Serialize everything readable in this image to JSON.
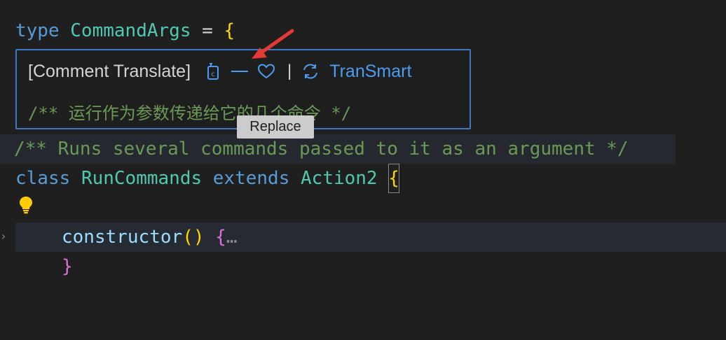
{
  "editor": {
    "line1": {
      "kw": "type",
      "name": "CommandArgs",
      "eq": "=",
      "brace": "{"
    },
    "line5": {
      "comment": "/** Runs several commands passed to it as an argument */"
    },
    "line6": {
      "kw": "class",
      "name": "RunCommands",
      "ext": "extends",
      "base": "Action2",
      "brace": "{"
    },
    "line8": {
      "fn": "constructor",
      "parens": "()",
      "brace": "{",
      "ellipsis": "…"
    },
    "line9": {
      "brace": "}"
    },
    "fold_glyph": "›"
  },
  "popup": {
    "title": "[Comment Translate]",
    "separator": "|",
    "link_label": "TranSmart",
    "translation": "/** 运行作为参数传递给它的几个命令 */",
    "buttons": {
      "replace": "replace-icon",
      "collapse": "minus-icon",
      "favorite": "heart-icon",
      "refresh": "refresh-icon"
    }
  },
  "tooltip": {
    "label": "Replace"
  },
  "colors": {
    "keyword": "#569cd6",
    "type": "#4ec9b0",
    "comment": "#6a9955",
    "brace": "#ffd700",
    "link": "#4a9df0",
    "annotation_arrow": "#e53935"
  }
}
